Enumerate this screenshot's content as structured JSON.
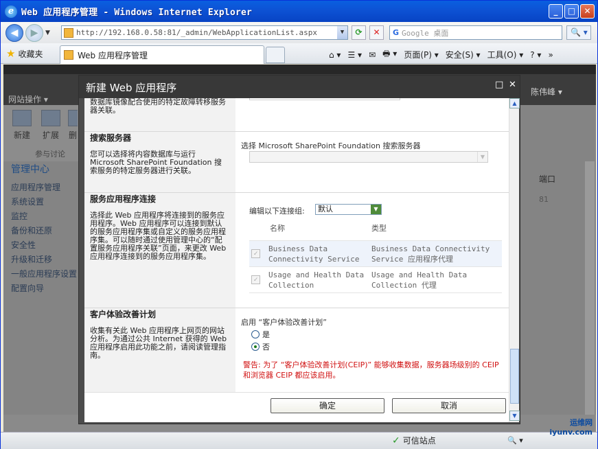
{
  "window": {
    "title": "Web 应用程序管理 - Windows Internet Explorer",
    "minimize": "_",
    "maximize": "□",
    "close": "✕"
  },
  "toolbar": {
    "back": "◀",
    "forward": "▶",
    "nav_dropdown": "▼",
    "url": "http://192.168.0.58:81/_admin/WebApplicationList.aspx",
    "refresh": "⟳",
    "stop": "✕",
    "search_placeholder": "Google 桌面",
    "search_engine": "G",
    "search_go": "🔍 ▾"
  },
  "favbar": {
    "favorites": "收藏夹",
    "tab_title": "Web 应用程序管理",
    "commands": [
      "⌂ ▾",
      "☰ ▾",
      "✉",
      "🖶 ▾",
      "页面(P) ▾",
      "安全(S) ▾",
      "工具(O) ▾",
      "? ▾",
      "»"
    ]
  },
  "sharepoint": {
    "site_actions": "网站操作 ▾",
    "user": "陈伟峰 ▾",
    "tools": [
      "新建",
      "扩展",
      "删"
    ],
    "group_label": "参与讨论",
    "quick_heading": "管理中心",
    "quick_items": [
      "应用程序管理",
      "系统设置",
      "监控",
      "备份和还原",
      "安全性",
      "升级和迁移",
      "一般应用程序设置",
      "配置向导"
    ],
    "column_port": "端口",
    "port_value": "81"
  },
  "dialog": {
    "title": "新建 Web 应用程序",
    "maximize": "□",
    "close": "✕",
    "sections": {
      "mirror": {
        "desc": "数据库镜像配合使用的特定故障转移服务器关联。"
      },
      "search": {
        "title": "搜索服务器",
        "desc": "您可以选择将内容数据库与运行 Microsoft SharePoint Foundation 搜索服务的特定服务器进行关联。",
        "label": "选择 Microsoft SharePoint Foundation 搜索服务器"
      },
      "proxy": {
        "title": "服务应用程序连接",
        "desc": "选择此 Web 应用程序将连接到的服务应用程序。Web 应用程序可以连接到默认的服务应用程序集或自定义的服务应用程序集。可以随时通过使用管理中心的“配置服务应用程序关联”页面，来更改 Web 应用程序连接到的服务应用程序集。",
        "edit_label": "编辑以下连接组:",
        "group_value": "默认",
        "col_name": "名称",
        "col_type": "类型",
        "rows": [
          {
            "name": "Business Data Connectivity Service",
            "type": "Business Data Connectivity Service 应用程序代理",
            "checked": true
          },
          {
            "name": "Usage and Health Data Collection",
            "type": "Usage and Health Data Collection 代理",
            "checked": true
          }
        ]
      },
      "ceip": {
        "title": "客户体验改善计划",
        "desc": "收集有关此 Web 应用程序上网页的网站分析。为通过公共 Internet 获得的 Web 应用程序启用此功能之前，请阅读管理指南。",
        "label": "启用 “客户体验改善计划”",
        "yes": "是",
        "no": "否",
        "selected": "否",
        "warning": "警告: 为了 “客户体验改善计划(CEIP)” 能够收集数据，服务器场级别的 CEIP 和浏览器 CEIP 都应该启用。"
      }
    },
    "ok": "确定",
    "cancel": "取消"
  },
  "status": {
    "zone": "可信站点",
    "zoom": "🔍 ▾"
  },
  "watermark": "运维网 iyunv.com"
}
